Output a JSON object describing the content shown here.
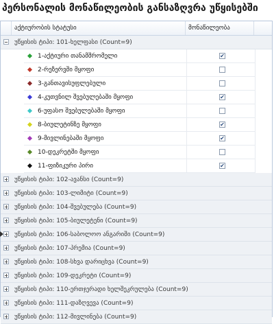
{
  "title": "პერსონალის მონაწილეობის განსაზღვრა უწყისებში",
  "columns": {
    "status": "აქტიურობის სტატუსი",
    "participation": "მონაწილეობა"
  },
  "expanded_group": {
    "label": "უწყისის ტიპი: 101-ხელფასი (Count=9)",
    "rows": [
      {
        "label": "1-აქტიური თანამშრომელი",
        "color": "#2aa13a",
        "checked": true
      },
      {
        "label": "2-რეზერვში მყოფი",
        "color": "#c0392b",
        "checked": false
      },
      {
        "label": "3-განთავისუფლებული",
        "color": "#8b2a2a",
        "checked": false
      },
      {
        "label": "4-კუთვნილ შვებულებაში მყოფი",
        "color": "#3b3bd6",
        "checked": true
      },
      {
        "label": "6-უფასო შვებულებაში მყოფი",
        "color": "#3fc9c9",
        "checked": false
      },
      {
        "label": "8-ბიულეტინზე მყოფი",
        "color": "#d4d41e",
        "checked": true
      },
      {
        "label": "9-მივლინებაში მყოფი",
        "color": "#a23ab8",
        "checked": true
      },
      {
        "label": "10-დეკრეტში მყოფი",
        "color": "#5a8a2a",
        "checked": false
      },
      {
        "label": "11-ფიზიკური პირი",
        "color": "#111111",
        "checked": true
      }
    ]
  },
  "collapsed_groups": [
    "უწყისის ტიპი: 102-ავანსი (Count=9)",
    "უწყისის ტიპი: 103-ლიმიტი (Count=9)",
    "უწყისის ტიპი: 104-შვებულება (Count=9)",
    "უწყისის ტიპი: 105-ბიულეტენი (Count=9)",
    "უწყისის ტიპი: 106-საბოლოო ანგარიში (Count=9)",
    "უწყისის ტიპი: 107-პრემია (Count=9)",
    "უწყისის ტიპი: 108-სხვა დარიცხვა (Count=9)",
    "უწყისის ტიპი: 109-დეკრეტი (Count=9)",
    "უწყისის ტიპი: 110-ერთჯერადი ხელშეკრულება (Count=9)",
    "უწყისის ტიპი: 111-დაზღვევა (Count=9)",
    "უწყისის ტიპი: 112-მივლინება (Count=9)"
  ]
}
